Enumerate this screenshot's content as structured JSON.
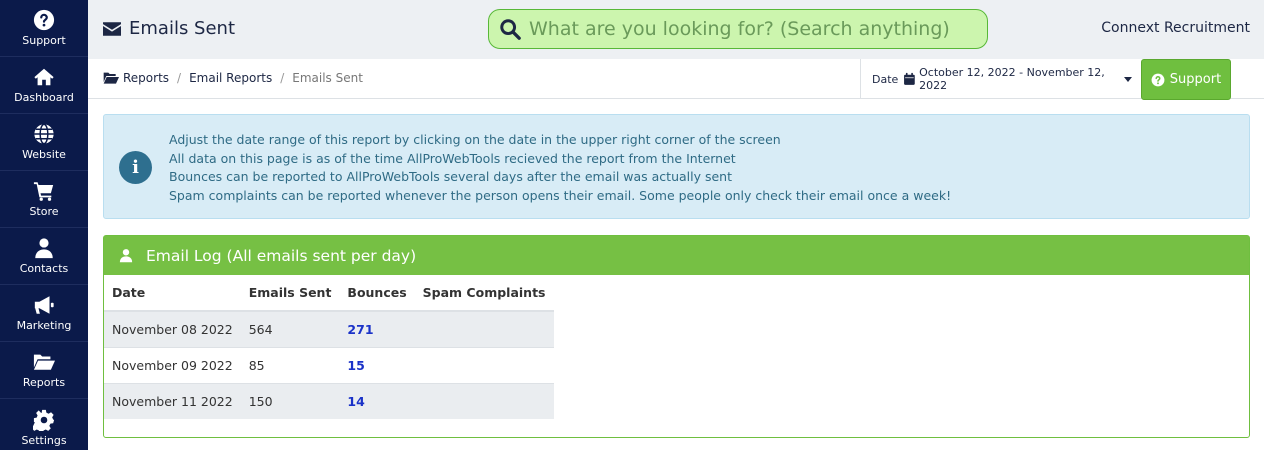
{
  "sidebar": {
    "items": [
      {
        "label": "Support",
        "icon": "question-circle-icon"
      },
      {
        "label": "Dashboard",
        "icon": "home-icon"
      },
      {
        "label": "Website",
        "icon": "globe-icon"
      },
      {
        "label": "Store",
        "icon": "cart-icon"
      },
      {
        "label": "Contacts",
        "icon": "user-icon"
      },
      {
        "label": "Marketing",
        "icon": "megaphone-icon"
      },
      {
        "label": "Reports",
        "icon": "folder-open-icon"
      },
      {
        "label": "Settings",
        "icon": "gear-icon"
      }
    ]
  },
  "header": {
    "title": "Emails Sent",
    "search_placeholder": "What are you looking for? (Search anything)",
    "company": "Connext Recruitment"
  },
  "breadcrumb": {
    "items": [
      "Reports",
      "Email Reports"
    ],
    "current": "Emails Sent"
  },
  "date_filter": {
    "label": "Date",
    "range": "October 12, 2022 - November 12, 2022"
  },
  "support_button": "Support",
  "alert": {
    "lines": [
      "Adjust the date range of this report by clicking on the date in the upper right corner of the screen",
      "All data on this page is as of the time AllProWebTools recieved the report from the Internet",
      "Bounces can be reported to AllProWebTools several days after the email was actually sent",
      "Spam complaints can be reported whenever the person opens their email. Some people only check their email once a week!"
    ]
  },
  "email_log": {
    "title": "Email Log (All emails sent per day)",
    "columns": [
      "Date",
      "Emails Sent",
      "Bounces",
      "Spam Complaints"
    ],
    "rows": [
      {
        "date": "November 08 2022",
        "sent": "564",
        "bounces": "271",
        "spam": ""
      },
      {
        "date": "November 09 2022",
        "sent": "85",
        "bounces": "15",
        "spam": ""
      },
      {
        "date": "November 11 2022",
        "sent": "150",
        "bounces": "14",
        "spam": ""
      }
    ]
  },
  "colors": {
    "sidebar": "#0b1a4a",
    "accent_green": "#76c044",
    "search_bg": "#ccf5ae",
    "info_bg": "#d8ecf6",
    "link_blue": "#1a32c8"
  }
}
